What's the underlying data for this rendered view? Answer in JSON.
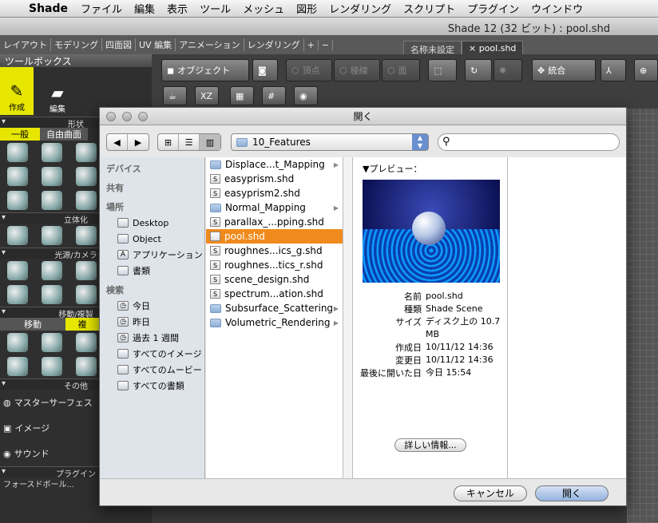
{
  "menubar": {
    "app": "Shade",
    "items": [
      "ファイル",
      "編集",
      "表示",
      "ツール",
      "メッシュ",
      "図形",
      "レンダリング",
      "スクリプト",
      "プラグイン",
      "ウインドウ"
    ]
  },
  "window": {
    "title": "Shade 12 (32 ビット) : pool.shd"
  },
  "workspace_tabs": [
    "レイアウト",
    "モデリング",
    "四面図",
    "UV 編集",
    "アニメーション",
    "レンダリング",
    "+",
    "−"
  ],
  "doc_tabs": [
    "名称未設定",
    "× pool.shd"
  ],
  "toolbox": {
    "title": "ツールボックス",
    "mode_labels": [
      "作成",
      "編集"
    ],
    "sections": {
      "shape": "形状",
      "solid": "立体化",
      "light": "光源/カメラ",
      "move": "移動/複製",
      "other": "その他",
      "plugin": "プラグイン"
    },
    "shape_tabs": [
      "一般",
      "自由曲面"
    ],
    "move_tabs": [
      "移動",
      "複"
    ],
    "items": [
      "マスターサーフェス",
      "イメージ",
      "サウンド"
    ],
    "footer": "フォースドボール..."
  },
  "toolbar": {
    "object": "オブジェクト",
    "vertex": "頂点",
    "edge": "稜線",
    "face": "面",
    "integrate": "統合",
    "xz": "XZ"
  },
  "dialog": {
    "title": "開く",
    "location": "10_Features",
    "search_placeholder": "",
    "sidebar": {
      "devices": "デバイス",
      "shared": "共有",
      "places": "場所",
      "place_items": [
        "Desktop",
        "Object",
        "アプリケーション",
        "書類"
      ],
      "search": "検索",
      "search_items": [
        "今日",
        "昨日",
        "過去 1 週間",
        "すべてのイメージ",
        "すべてのムービー",
        "すべての書類"
      ]
    },
    "files": [
      {
        "name": "Displace...t_Mapping",
        "type": "folder"
      },
      {
        "name": "easyprism.shd",
        "type": "file"
      },
      {
        "name": "easyprism2.shd",
        "type": "file"
      },
      {
        "name": "Normal_Mapping",
        "type": "folder"
      },
      {
        "name": "parallax_...pping.shd",
        "type": "file"
      },
      {
        "name": "pool.shd",
        "type": "file",
        "selected": true
      },
      {
        "name": "roughnes...ics_g.shd",
        "type": "file"
      },
      {
        "name": "roughnes...tics_r.shd",
        "type": "file"
      },
      {
        "name": "scene_design.shd",
        "type": "file"
      },
      {
        "name": "spectrum...ation.shd",
        "type": "file"
      },
      {
        "name": "Subsurface_Scattering",
        "type": "folder"
      },
      {
        "name": "Volumetric_Rendering",
        "type": "folder"
      }
    ],
    "preview": {
      "label": "▼プレビュー：",
      "meta": [
        {
          "k": "名前",
          "v": "pool.shd"
        },
        {
          "k": "種類",
          "v": "Shade Scene"
        },
        {
          "k": "サイズ",
          "v": "ディスク上の 10.7 MB"
        },
        {
          "k": "作成日",
          "v": "10/11/12 14:36"
        },
        {
          "k": "変更日",
          "v": "10/11/12 14:36"
        },
        {
          "k": "最後に開いた日",
          "v": "今日 15:54"
        }
      ],
      "more_button": "詳しい情報..."
    },
    "cancel": "キャンセル",
    "open": "開く"
  }
}
